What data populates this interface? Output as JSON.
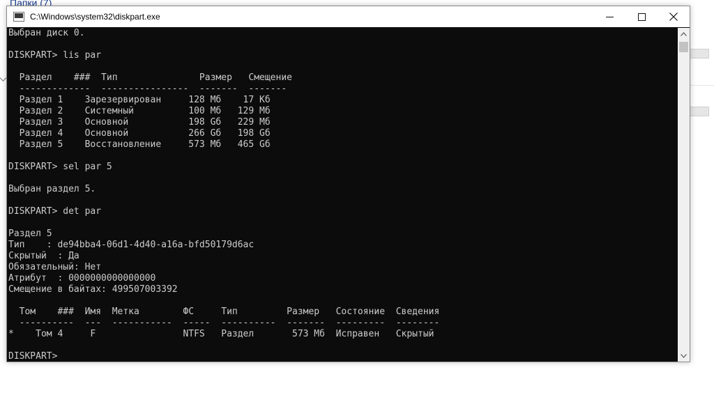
{
  "background": {
    "folder_label": "Папки (7)"
  },
  "window": {
    "title": "C:\\Windows\\system32\\diskpart.exe"
  },
  "console": {
    "lines": [
      "Выбран диск 0.",
      "",
      "DISKPART> lis par",
      "",
      "  Раздел    ###  Тип               Размер   Смещение",
      "  -------------  ----------------  -------  -------",
      "  Раздел 1    Зарезервирован     128 Мб    17 Кб",
      "  Раздел 2    Системный          100 Мб   129 Мб",
      "  Раздел 3    Основной           198 Gб   229 Мб",
      "  Раздел 4    Основной           266 Gб   198 Gб",
      "  Раздел 5    Восстановление     573 Мб   465 Gб",
      "",
      "DISKPART> sel par 5",
      "",
      "Выбран раздел 5.",
      "",
      "DISKPART> det par",
      "",
      "Раздел 5",
      "Тип    : de94bba4-06d1-4d40-a16a-bfd50179d6ac",
      "Скрытый  : Да",
      "Обязательный: Нет",
      "Атрибут  : 0000000000000000",
      "Смещение в байтах: 499507003392",
      "",
      "  Том    ###  Имя  Метка        ФС     Тип         Размер   Состояние  Сведения",
      "  ----------  ---  -----------  -----  ----------  -------  ---------  --------",
      "*    Том 4     F                NTFS   Раздел       573 Мб  Исправен   Скрытый",
      "",
      "DISKPART> "
    ]
  }
}
